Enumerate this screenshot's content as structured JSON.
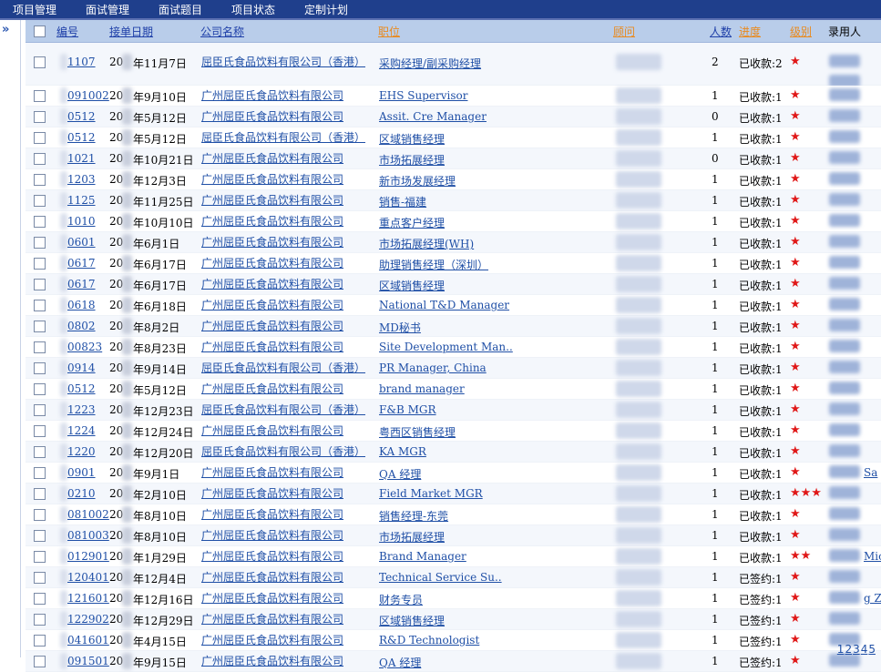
{
  "nav": {
    "items": [
      "项目管理",
      "面试管理",
      "面试题目",
      "项目状态",
      "定制计划"
    ]
  },
  "sidebar": {
    "expand_glyph": "»",
    "icon": "double-chevron-right-icon"
  },
  "table": {
    "headers": {
      "id": "编号",
      "date": "接单日期",
      "company": "公司名称",
      "position": "职位",
      "consultant": "顾问",
      "count": "人数",
      "progress": "进度",
      "level": "级别",
      "hired": "录用人"
    },
    "rows": [
      {
        "id": "1107",
        "date": "年11月7日",
        "company": "屈臣氏食品饮料有限公司（香港）",
        "position": "采购经理/副采购经理",
        "count": "2",
        "status": "已收款:2",
        "stars": "★",
        "tall": true
      },
      {
        "id": "091002",
        "date": "年9月10日",
        "company": "广州屈臣氏食品饮料有限公司",
        "position": "EHS Supervisor",
        "count": "1",
        "status": "已收款:1",
        "stars": "★"
      },
      {
        "id": "0512",
        "date": "年5月12日",
        "company": "广州屈臣氏食品饮料有限公司",
        "position": "Assit. Cre Manager",
        "count": "0",
        "status": "已收款:1",
        "stars": "★"
      },
      {
        "id": "0512",
        "date": "年5月12日",
        "company": "屈臣氏食品饮料有限公司（香港）",
        "position": "区域销售经理",
        "count": "1",
        "status": "已收款:1",
        "stars": "★"
      },
      {
        "id": "1021",
        "date": "年10月21日",
        "company": "广州屈臣氏食品饮料有限公司",
        "position": "市场拓展经理",
        "count": "0",
        "status": "已收款:1",
        "stars": "★"
      },
      {
        "id": "1203",
        "date": "年12月3日",
        "company": "广州屈臣氏食品饮料有限公司",
        "position": "新市场发展经理",
        "count": "1",
        "status": "已收款:1",
        "stars": "★"
      },
      {
        "id": "1125",
        "date": "年11月25日",
        "company": "广州屈臣氏食品饮料有限公司",
        "position": "销售-福建",
        "count": "1",
        "status": "已收款:1",
        "stars": "★"
      },
      {
        "id": "1010",
        "date": "年10月10日",
        "company": "广州屈臣氏食品饮料有限公司",
        "position": "重点客户经理",
        "count": "1",
        "status": "已收款:1",
        "stars": "★"
      },
      {
        "id": "0601",
        "date": "年6月1日",
        "company": "广州屈臣氏食品饮料有限公司",
        "position": "市场拓展经理(WH)",
        "count": "1",
        "status": "已收款:1",
        "stars": "★"
      },
      {
        "id": "0617",
        "date": "年6月17日",
        "company": "广州屈臣氏食品饮料有限公司",
        "position": "助理销售经理（深圳）",
        "count": "1",
        "status": "已收款:1",
        "stars": "★"
      },
      {
        "id": "0617",
        "date": "年6月17日",
        "company": "广州屈臣氏食品饮料有限公司",
        "position": "区域销售经理",
        "count": "1",
        "status": "已收款:1",
        "stars": "★"
      },
      {
        "id": "0618",
        "date": "年6月18日",
        "company": "广州屈臣氏食品饮料有限公司",
        "position": "National T&D Manager",
        "count": "1",
        "status": "已收款:1",
        "stars": "★"
      },
      {
        "id": "0802",
        "date": "年8月2日",
        "company": "广州屈臣氏食品饮料有限公司",
        "position": "MD秘书",
        "count": "1",
        "status": "已收款:1",
        "stars": "★"
      },
      {
        "id": "00823",
        "date": "年8月23日",
        "company": "广州屈臣氏食品饮料有限公司",
        "position": "Site Development Man..",
        "count": "1",
        "status": "已收款:1",
        "stars": "★"
      },
      {
        "id": "0914",
        "date": "年9月14日",
        "company": "屈臣氏食品饮料有限公司（香港）",
        "position": "PR Manager, China",
        "count": "1",
        "status": "已收款:1",
        "stars": "★"
      },
      {
        "id": "0512",
        "date": "年5月12日",
        "company": "广州屈臣氏食品饮料有限公司",
        "position": "brand manager",
        "count": "1",
        "status": "已收款:1",
        "stars": "★"
      },
      {
        "id": "1223",
        "date": "年12月23日",
        "company": "屈臣氏食品饮料有限公司（香港）",
        "position": "F&B MGR",
        "count": "1",
        "status": "已收款:1",
        "stars": "★"
      },
      {
        "id": "1224",
        "date": "年12月24日",
        "company": "广州屈臣氏食品饮料有限公司",
        "position": "粤西区销售经理",
        "count": "1",
        "status": "已收款:1",
        "stars": "★"
      },
      {
        "id": "1220",
        "date": "年12月20日",
        "company": "屈臣氏食品饮料有限公司（香港）",
        "position": "KA MGR",
        "count": "1",
        "status": "已收款:1",
        "stars": "★"
      },
      {
        "id": "0901",
        "date": "年9月1日",
        "company": "广州屈臣氏食品饮料有限公司",
        "position": "QA 经理",
        "count": "1",
        "status": "已收款:1",
        "stars": "★",
        "hired_tail": "Sa"
      },
      {
        "id": "0210",
        "date": "年2月10日",
        "company": "广州屈臣氏食品饮料有限公司",
        "position": "Field Market MGR",
        "count": "1",
        "status": "已收款:1",
        "stars": "★★★"
      },
      {
        "id": "081002",
        "date": "年8月10日",
        "company": "广州屈臣氏食品饮料有限公司",
        "position": "销售经理-东莞",
        "count": "1",
        "status": "已收款:1",
        "stars": "★"
      },
      {
        "id": "081003",
        "date": "年8月10日",
        "company": "广州屈臣氏食品饮料有限公司",
        "position": "市场拓展经理",
        "count": "1",
        "status": "已收款:1",
        "stars": "★"
      },
      {
        "id": "012901",
        "date": "年1月29日",
        "company": "广州屈臣氏食品饮料有限公司",
        "position": "Brand Manager",
        "count": "1",
        "status": "已收款:1",
        "stars": "★★",
        "hired_tail": "Mic"
      },
      {
        "id": "120401",
        "date": "年12月4日",
        "company": "广州屈臣氏食品饮料有限公司",
        "position": "Technical Service Su..",
        "count": "1",
        "status": "已签约:1",
        "stars": "★"
      },
      {
        "id": "121601",
        "date": "年12月16日",
        "company": "广州屈臣氏食品饮料有限公司",
        "position": "财务专员",
        "count": "1",
        "status": "已签约:1",
        "stars": "★",
        "hired_tail": "g Z"
      },
      {
        "id": "122902",
        "date": "年12月29日",
        "company": "广州屈臣氏食品饮料有限公司",
        "position": "区域销售经理",
        "count": "1",
        "status": "已签约:1",
        "stars": "★"
      },
      {
        "id": "041601",
        "date": "年4月15日",
        "company": "广州屈臣氏食品饮料有限公司",
        "position": "R&D Technologist",
        "count": "1",
        "status": "已签约:1",
        "stars": "★"
      },
      {
        "id": "091501",
        "date": "年9月15日",
        "company": "广州屈臣氏食品饮料有限公司",
        "position": "QA 经理",
        "count": "1",
        "status": "已签约:1",
        "stars": "★"
      }
    ]
  },
  "pagination": {
    "pages": [
      "1",
      "2",
      "3",
      "4",
      "5"
    ]
  },
  "colors": {
    "nav_bg": "#1f3f8c",
    "header_bg": "#b9cdea",
    "link": "#1f4fa6",
    "orange": "#e98a1e",
    "star": "#e01818"
  }
}
